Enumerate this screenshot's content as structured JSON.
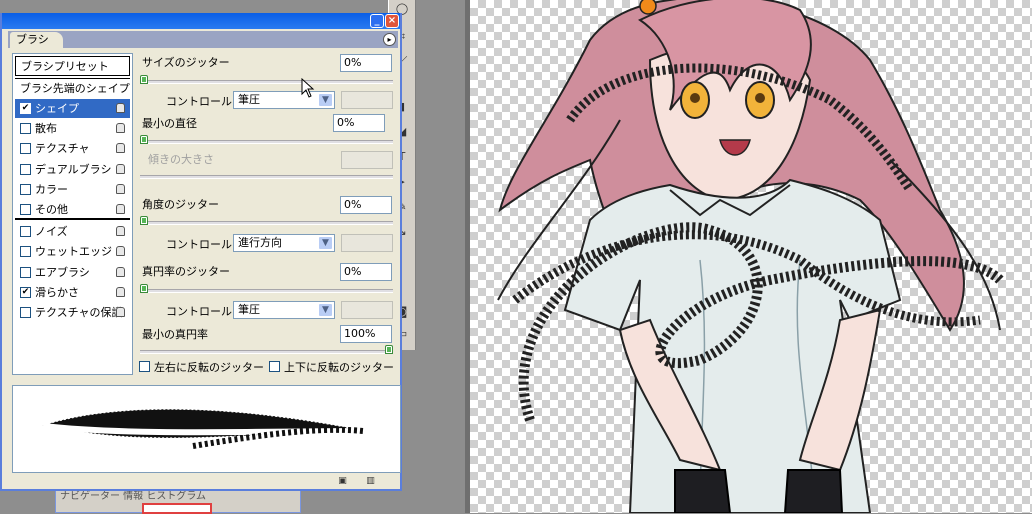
{
  "window": {
    "tab_label": "ブラシ",
    "minimize_glyph": "_",
    "close_glyph": "×",
    "menu_glyph": "▸"
  },
  "leftlist": {
    "preset_header": "ブラシプリセット",
    "tip_header": "ブラシ先端のシェイプ",
    "items": [
      {
        "label": "シェイプ",
        "checked": true,
        "selected": true
      },
      {
        "label": "散布",
        "checked": false,
        "selected": false
      },
      {
        "label": "テクスチャ",
        "checked": false,
        "selected": false
      },
      {
        "label": "デュアルブラシ",
        "checked": false,
        "selected": false
      },
      {
        "label": "カラー",
        "checked": false,
        "selected": false
      },
      {
        "label": "その他",
        "checked": false,
        "selected": false
      },
      {
        "label": "ノイズ",
        "checked": false,
        "selected": false
      },
      {
        "label": "ウェットエッジ",
        "checked": false,
        "selected": false
      },
      {
        "label": "エアブラシ",
        "checked": false,
        "selected": false
      },
      {
        "label": "滑らかさ",
        "checked": true,
        "selected": false
      },
      {
        "label": "テクスチャの保護",
        "checked": false,
        "selected": false
      }
    ]
  },
  "shape": {
    "size_jitter_label": "サイズのジッター",
    "size_jitter_value": "0%",
    "control_label": "コントロール：",
    "control1_value": "筆圧",
    "min_diameter_label": "最小の直径",
    "min_diameter_value": "0%",
    "tilt_scale_label": "傾きの大きさ",
    "angle_jitter_label": "角度のジッター",
    "angle_jitter_value": "0%",
    "control2_value": "進行方向",
    "roundness_jitter_label": "真円率のジッター",
    "roundness_jitter_value": "0%",
    "control3_value": "筆圧",
    "min_roundness_label": "最小の真円率",
    "min_roundness_value": "100%",
    "flip_x_label": "左右に反転のジッター",
    "flip_y_label": "上下に反転のジッター",
    "arrow_glyph": "▼"
  },
  "under_panel": {
    "tabs_text": "ナビゲーター  情報  ヒストグラム"
  },
  "colors": {
    "title_blue": "#0a5ee6",
    "selection": "#316ac5",
    "slider_knob": "#56b656",
    "hair": "#c98a98"
  }
}
